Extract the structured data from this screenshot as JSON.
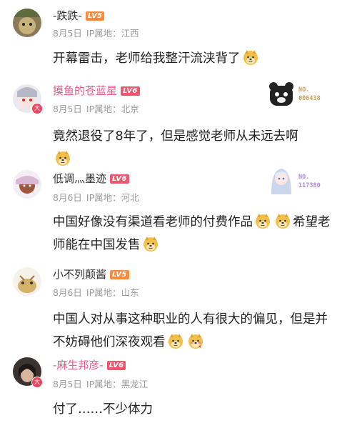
{
  "comments": [
    {
      "username": "-跌跌-",
      "level": "LV5",
      "date": "8月5日",
      "ip_label": "IP属地：",
      "location": "江西",
      "text": "开幕雷击，老师给我整汗流浃背了",
      "has_badge": false
    },
    {
      "username": "摸鱼的苍蓝星",
      "level": "LV6",
      "date": "8月5日",
      "ip_label": "IP属地：",
      "location": "北京",
      "text": "竟然退役了8年了，但是感觉老师从未远去啊",
      "decoration_label": "NO.\n006438",
      "badge_text": "大"
    },
    {
      "username": "低调灬墨迹",
      "level": "LV6",
      "date": "8月6日",
      "ip_label": "IP属地：",
      "location": "河北",
      "text_part1": "中国好像没有渠道看老师的付费作品",
      "text_part2": "希望老师能在中国发售",
      "decoration_label": "NO.\n117380"
    },
    {
      "username": "小不列颠酱",
      "level": "LV5",
      "date": "8月6日",
      "ip_label": "IP属地：",
      "location": "山东",
      "text": "中国人对从事这种职业的人有很大的偏见，但是并不妨碍他们深夜观看"
    },
    {
      "username": "-麻生邦彦-",
      "level": "LV6",
      "date": "8月5日",
      "ip_label": "IP属地：",
      "location": "黑龙江",
      "text": "付了……不少体力",
      "badge_text": "大"
    }
  ],
  "colors": {
    "pink_name": "#e85a8a",
    "lv5": "#ff8a3c",
    "lv6": "#f0566c",
    "deco_label": "#c9a25a",
    "deco_label2": "#b08ad8"
  },
  "icons": [
    "doge-emoji",
    "doge-emoji-smirk",
    "blushing-doge-emoji"
  ]
}
